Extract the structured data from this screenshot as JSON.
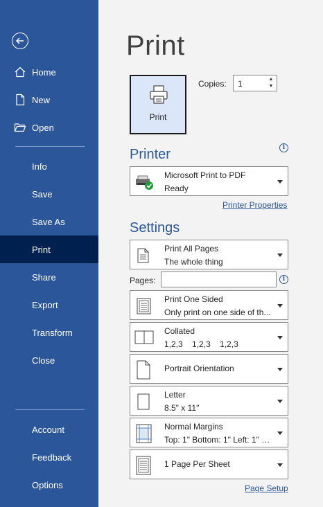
{
  "sidebar": {
    "back": "back-arrow-icon",
    "items": [
      {
        "label": "Home",
        "icon": "home-icon"
      },
      {
        "label": "New",
        "icon": "new-document-icon"
      },
      {
        "label": "Open",
        "icon": "open-folder-icon"
      },
      {
        "label": "Info"
      },
      {
        "label": "Save"
      },
      {
        "label": "Save As"
      },
      {
        "label": "Print",
        "active": true
      },
      {
        "label": "Share"
      },
      {
        "label": "Export"
      },
      {
        "label": "Transform"
      },
      {
        "label": "Close"
      },
      {
        "label": "Account"
      },
      {
        "label": "Feedback"
      },
      {
        "label": "Options"
      }
    ]
  },
  "main": {
    "title": "Print",
    "print_button_label": "Print",
    "copies_label": "Copies:",
    "copies_value": "1",
    "printer_heading": "Printer",
    "printer": {
      "name": "Microsoft Print to PDF",
      "status": "Ready"
    },
    "printer_properties_link": "Printer Properties",
    "settings_heading": "Settings",
    "pages_label": "Pages:",
    "pages_value": "",
    "settings": [
      {
        "line1": "Print All Pages",
        "line2": "The whole thing"
      },
      {
        "line1": "Print One Sided",
        "line2": "Only print on one side of th..."
      },
      {
        "line1": "Collated",
        "line2": "1,2,3    1,2,3    1,2,3"
      },
      {
        "line1": "Portrait Orientation",
        "line2": ""
      },
      {
        "line1": "Letter",
        "line2": "8.5\" x 11\""
      },
      {
        "line1": "Normal Margins",
        "line2": "Top: 1\" Bottom: 1\" Left: 1\" Ri..."
      },
      {
        "line1": "1 Page Per Sheet",
        "line2": ""
      }
    ],
    "page_setup_link": "Page Setup"
  },
  "colors": {
    "sidebar_bg": "#2b579a",
    "sidebar_active": "#002050",
    "accent": "#2b579a",
    "print_button_bg": "#dbe7f8"
  }
}
